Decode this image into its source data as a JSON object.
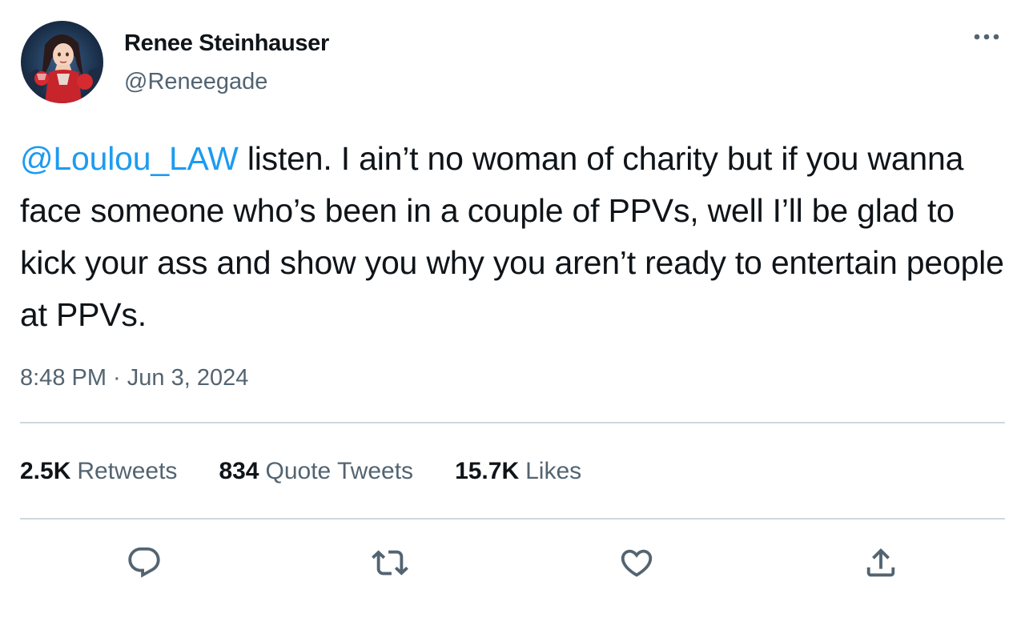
{
  "author": {
    "display_name": "Renee Steinhauser",
    "handle": "@Reneegade"
  },
  "tweet": {
    "mention": "@Loulou_LAW",
    "text": " listen. I ain’t no woman of charity but if you wanna face someone who’s been in a couple of PPVs, well I’ll be glad to kick your ass and show you why you aren’t ready to entertain people at PPVs.",
    "timestamp": "8:48 PM · Jun 3, 2024"
  },
  "stats": {
    "retweets_count": "2.5K",
    "retweets_label": "Retweets",
    "quotes_count": "834",
    "quotes_label": "Quote Tweets",
    "likes_count": "15.7K",
    "likes_label": "Likes"
  },
  "icons": {
    "more": "more-dots-icon",
    "reply": "reply-icon",
    "retweet": "retweet-icon",
    "like": "heart-icon",
    "share": "share-icon"
  },
  "colors": {
    "text_primary": "#0f1419",
    "text_secondary": "#536471",
    "link": "#1d9bf0",
    "divider": "#cfd9de"
  }
}
